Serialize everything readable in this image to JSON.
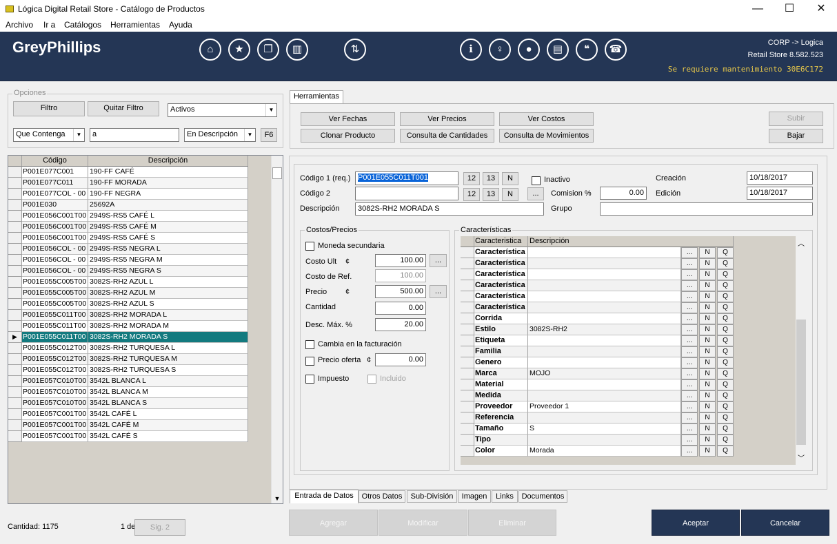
{
  "window": {
    "title": "Lógica Digital Retail Store - Catálogo de Productos",
    "controls": {
      "minimize": "—",
      "maximize": "☐",
      "close": "✕"
    }
  },
  "menu": [
    "Archivo",
    "Ir a",
    "Catálogos",
    "Herramientas",
    "Ayuda"
  ],
  "header": {
    "brand": "GreyPhillips",
    "nav_icons": [
      "home-icon",
      "star-icon",
      "copy-icon",
      "building-icon",
      "sort-icon",
      "info-icon",
      "lightbulb-icon",
      "chat-icon",
      "id-card-icon",
      "quote-icon",
      "support-icon"
    ],
    "company": "CORP -> Logica",
    "version": "Retail Store 8.582.523",
    "maintenance": "Se requiere mantenimiento 30E6C172",
    "colors": {
      "bg": "#243655",
      "warning": "#e8c84a"
    }
  },
  "options": {
    "title": "Opciones",
    "filter_button": "Filtro",
    "clear_filter_button": "Quitar Filtro",
    "status_select": "Activos",
    "match_select": "Que Contenga",
    "search_value": "a",
    "field_select": "En Descripción",
    "f6_button": "F6"
  },
  "product_grid": {
    "columns": [
      "Código",
      "Descripción"
    ],
    "rows": [
      [
        "P001E077C001",
        "190-FF CAFÉ"
      ],
      [
        "P001E077C011",
        "190-FF MORADA"
      ],
      [
        "P001E077COL  - 00",
        "190-FF NEGRA"
      ],
      [
        "P001E030",
        "25692A"
      ],
      [
        "P001E056C001T00",
        "2949S-RS5 CAFÉ L"
      ],
      [
        "P001E056C001T00",
        "2949S-RS5 CAFÉ M"
      ],
      [
        "P001E056C001T00",
        "2949S-RS5 CAFÉ S"
      ],
      [
        "P001E056COL  - 00",
        "2949S-RS5 NEGRA L"
      ],
      [
        "P001E056COL  - 00",
        "2949S-RS5 NEGRA M"
      ],
      [
        "P001E056COL  - 00",
        "2949S-RS5 NEGRA S"
      ],
      [
        "P001E055C005T00",
        "3082S-RH2 AZUL L"
      ],
      [
        "P001E055C005T00",
        "3082S-RH2 AZUL M"
      ],
      [
        "P001E055C005T00",
        "3082S-RH2 AZUL S"
      ],
      [
        "P001E055C011T00",
        "3082S-RH2 MORADA L"
      ],
      [
        "P001E055C011T00",
        "3082S-RH2 MORADA M"
      ],
      [
        "P001E055C011T00",
        "3082S-RH2 MORADA S"
      ],
      [
        "P001E055C012T00",
        "3082S-RH2 TURQUESA L"
      ],
      [
        "P001E055C012T00",
        "3082S-RH2 TURQUESA M"
      ],
      [
        "P001E055C012T00",
        "3082S-RH2 TURQUESA S"
      ],
      [
        "P001E057C010T00",
        "3542L BLANCA L"
      ],
      [
        "P001E057C010T00",
        "3542L BLANCA M"
      ],
      [
        "P001E057C010T00",
        "3542L BLANCA S"
      ],
      [
        "P001E057C001T00",
        "3542L CAFÉ L"
      ],
      [
        "P001E057C001T00",
        "3542L CAFÉ M"
      ],
      [
        "P001E057C001T00",
        "3542L CAFÉ S"
      ]
    ],
    "selected_index": 15,
    "selected_color": "#137a7f"
  },
  "footer": {
    "count": "Cantidad: 1175",
    "page": "1 de",
    "next_button": "Sig. 2"
  },
  "tools": {
    "tab": "Herramientas",
    "ver_fechas": "Ver Fechas",
    "ver_precios": "Ver Precios",
    "ver_costos": "Ver Costos",
    "clonar": "Clonar Producto",
    "consulta_cantidades": "Consulta de Cantidades",
    "consulta_movimientos": "Consulta de Movimientos",
    "subir": "Subir",
    "bajar": "Bajar"
  },
  "form": {
    "codigo1_label": "Código 1 (req.)",
    "codigo1_value": "P001E055C011T001",
    "codigo2_label": "Código 2",
    "codigo2_value": "",
    "descripcion_label": "Descripción",
    "descripcion_value": "3082S-RH2 MORADA S",
    "btn12": "12",
    "btn13": "13",
    "btnN": "N",
    "btnDots": "...",
    "inactivo_label": "Inactivo",
    "comision_label": "Comision %",
    "comision_value": "0.00",
    "grupo_label": "Grupo",
    "grupo_value": "",
    "creacion_label": "Creación",
    "creacion_value": "10/18/2017",
    "edicion_label": "Edición",
    "edicion_value": "10/18/2017"
  },
  "costs": {
    "title": "Costos/Precios",
    "moneda": "Moneda secundaria",
    "costo_ult_label": "Costo Ult",
    "currency": "¢",
    "costo_ult": "100.00",
    "costo_ref_label": "Costo de Ref.",
    "costo_ref": "100.00",
    "precio_label": "Precio",
    "precio": "500.00",
    "cantidad_label": "Cantidad",
    "cantidad": "0.00",
    "desc_label": "Desc. Máx. %",
    "desc": "20.00",
    "cambia": "Cambia en la facturación",
    "precio_oferta": "Precio oferta",
    "precio_oferta_value": "0.00",
    "impuesto": "Impuesto",
    "incluido": "Incluido"
  },
  "characteristics": {
    "title": "Características",
    "columns": [
      "Caracteristica",
      "Descripción"
    ],
    "rows": [
      [
        "Característica",
        ""
      ],
      [
        "Característica",
        ""
      ],
      [
        "Característica",
        ""
      ],
      [
        "Característica",
        ""
      ],
      [
        "Característica",
        ""
      ],
      [
        "Característica",
        ""
      ],
      [
        "Corrida",
        ""
      ],
      [
        "Estilo",
        "3082S-RH2"
      ],
      [
        "Etiqueta",
        ""
      ],
      [
        "Familia",
        ""
      ],
      [
        "Genero",
        ""
      ],
      [
        "Marca",
        "MOJO"
      ],
      [
        "Material",
        ""
      ],
      [
        "Medida",
        ""
      ],
      [
        "Proveedor",
        "Proveedor 1"
      ],
      [
        "Referencia",
        ""
      ],
      [
        "Tamaño",
        "S"
      ],
      [
        "Tipo",
        ""
      ],
      [
        "Color",
        "Morada"
      ]
    ],
    "btn_dots": "...",
    "btn_n": "N",
    "btn_q": "Q"
  },
  "bottom_tabs": [
    "Entrada de Datos",
    "Otros Datos",
    "Sub-División",
    "Imagen",
    "Links",
    "Documentos"
  ],
  "actions": {
    "agregar": "Agregar",
    "modificar": "Modificar",
    "eliminar": "Eliminar",
    "aceptar": "Aceptar",
    "cancelar": "Cancelar"
  }
}
